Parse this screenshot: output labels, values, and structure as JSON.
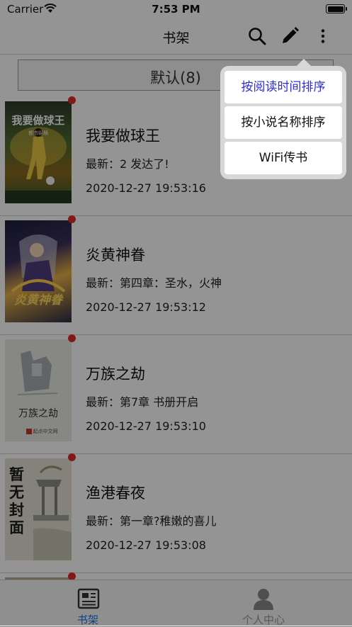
{
  "status_bar": {
    "carrier": "Carrier",
    "time": "7:53 PM"
  },
  "nav": {
    "title": "书架",
    "icons": [
      "search-icon",
      "edit-pencil-icon",
      "more-vertical-icon"
    ]
  },
  "group_button": {
    "label": "默认(8)"
  },
  "books": [
    {
      "title": "我要做球王",
      "latest": "最新：2 发达了!",
      "time": "2020-12-27 19:53:16",
      "cover_text": "我要做球王",
      "cover_author": "都市纵横"
    },
    {
      "title": "炎黄神眷",
      "latest": "最新：第四章：圣水，火神",
      "time": "2020-12-27 19:53:12",
      "cover_text": "炎黄神眷",
      "cover_author": ""
    },
    {
      "title": "万族之劫",
      "latest": "最新：第7章 书册开启",
      "time": "2020-12-27 19:53:10",
      "cover_text": "万族之劫",
      "cover_author": "起点中文网"
    },
    {
      "title": "渔港春夜",
      "latest": "最新：第一章?稚嫩的喜儿",
      "time": "2020-12-27 19:53:08",
      "cover_text": "暂无封面",
      "cover_author": ""
    }
  ],
  "popup_menu": {
    "items": [
      {
        "label": "按阅读时间排序",
        "selected": true
      },
      {
        "label": "按小说名称排序",
        "selected": false
      },
      {
        "label": "WiFi传书",
        "selected": false
      }
    ]
  },
  "tab_bar": {
    "tabs": [
      {
        "label": "书架",
        "icon": "bookshelf-icon",
        "active": true
      },
      {
        "label": "个人中心",
        "icon": "person-icon",
        "active": false
      }
    ]
  },
  "colors": {
    "accent": "#1a73e8",
    "menu_selected": "#2d2dd8",
    "unread_dot": "#e12b2b"
  }
}
